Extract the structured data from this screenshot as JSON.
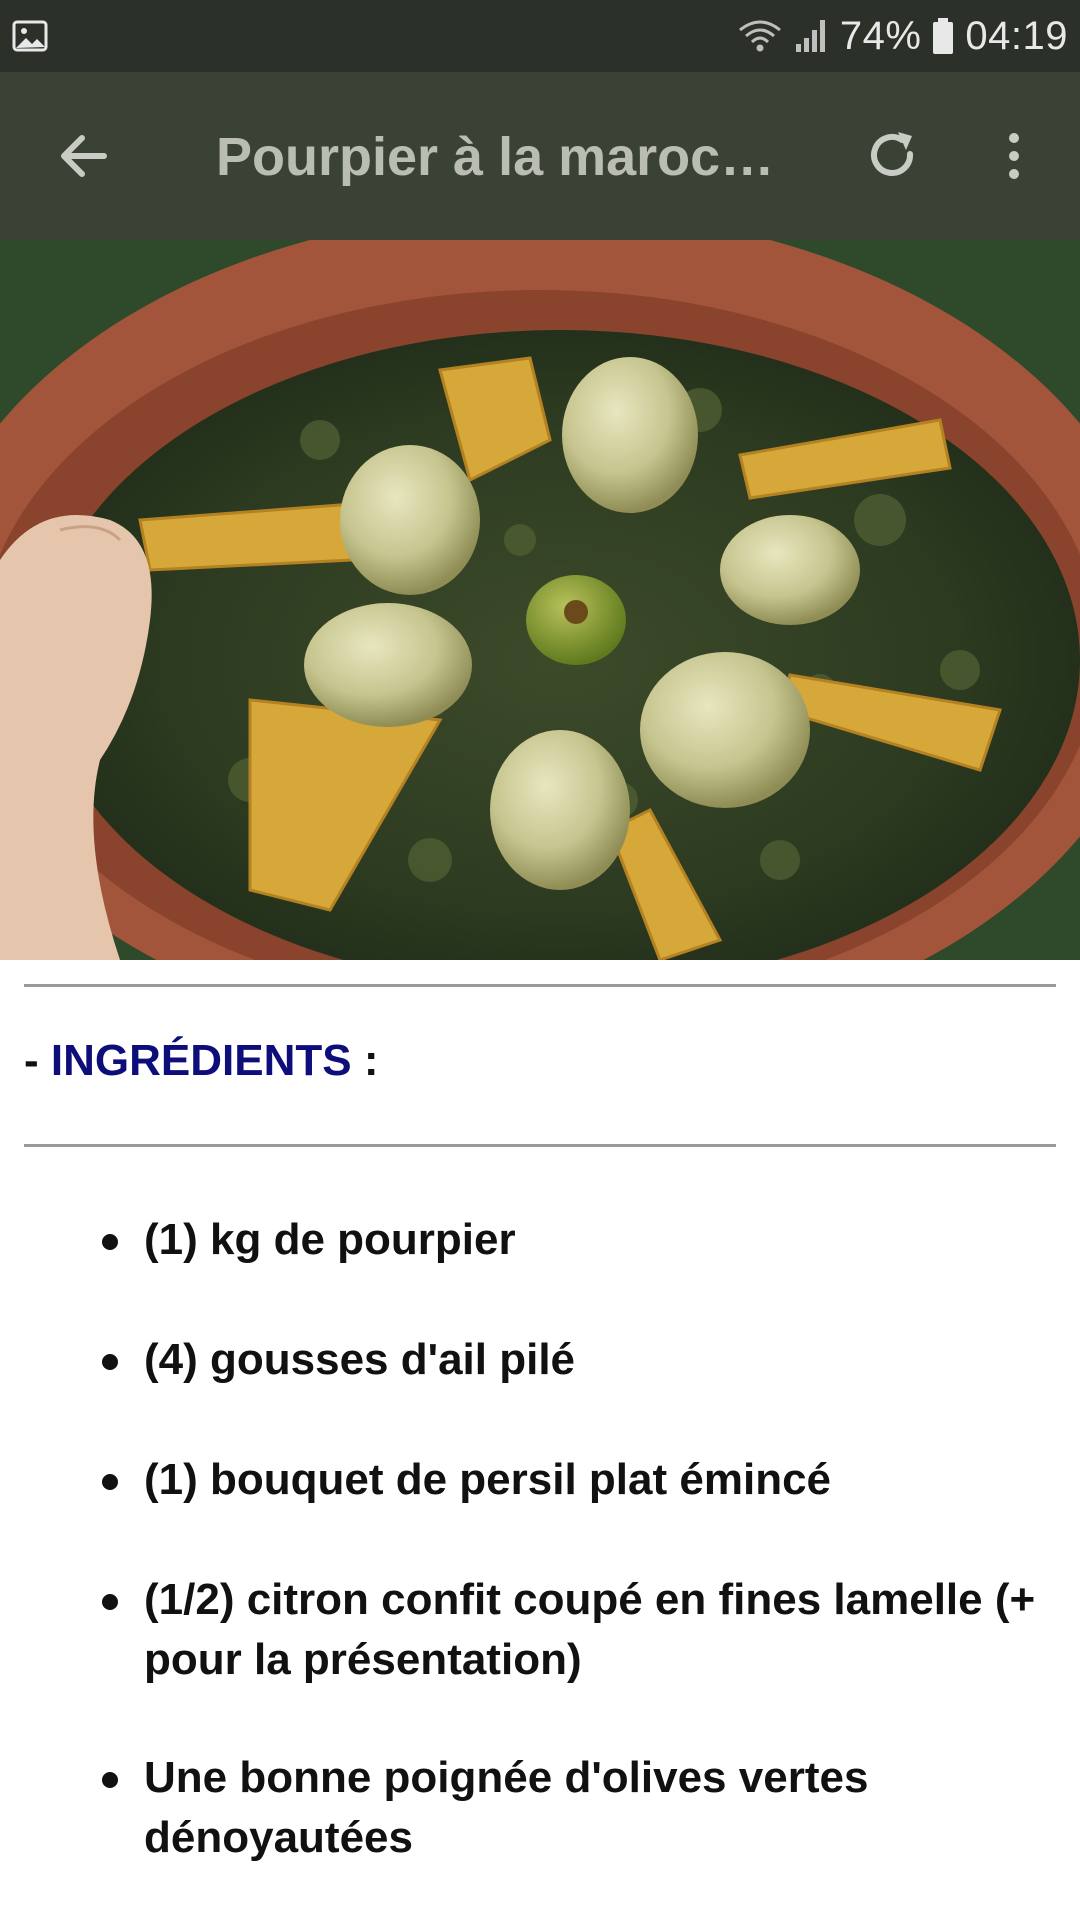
{
  "status_bar": {
    "battery": "74%",
    "time": "04:19",
    "icons": [
      "gallery-icon",
      "wifi-icon",
      "signal-icon",
      "battery-icon"
    ]
  },
  "app_bar": {
    "title": "Pourpier à la maroc…",
    "icons": [
      "back-arrow-icon",
      "refresh-icon",
      "more-vertical-icon"
    ]
  },
  "hero": {
    "alt": "photo"
  },
  "section": {
    "prefix": "- ",
    "heading": "INGRÉDIENTS",
    "suffix": " :"
  },
  "ingredients": [
    {
      "text": "(1) kg de pourpier"
    },
    {
      "text": "(4) gousses d'ail pilé"
    },
    {
      "text": "(1) bouquet de persil plat émincé"
    },
    {
      "text": "(1/2) citron confit coupé en fines lamelle (+ pour la présentation)"
    },
    {
      "text": "Une bonne poignée d'olives vertes dénoyautées"
    }
  ],
  "colors": {
    "status_bar": "#2b3028",
    "app_bar": "#3a4236",
    "title_text": "#b9bdb3",
    "heading_accent": "#0e0e7a"
  }
}
